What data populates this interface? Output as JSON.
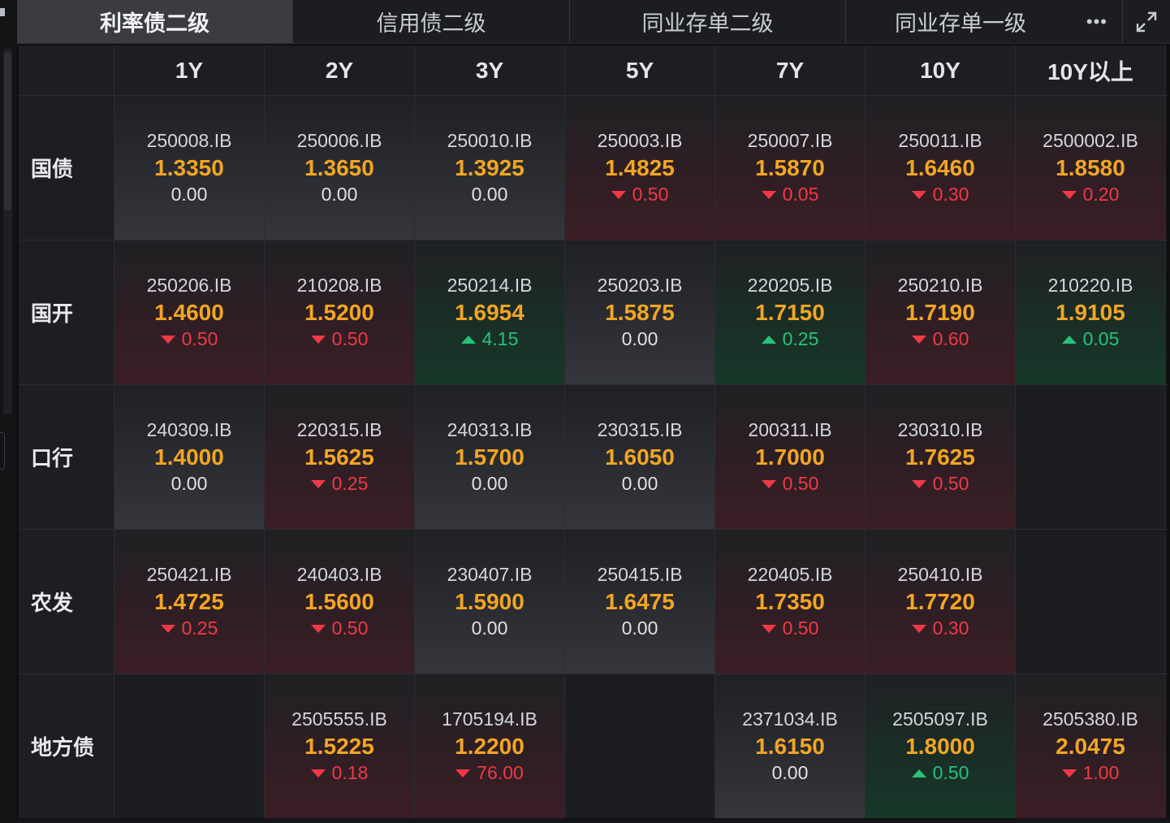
{
  "tabs": [
    {
      "label": "利率债二级",
      "active": true
    },
    {
      "label": "信用债二级",
      "active": false
    },
    {
      "label": "同业存单二级",
      "active": false
    },
    {
      "label": "同业存单一级",
      "active": false
    }
  ],
  "icons": {
    "more": "more-horizontal-icon",
    "expand": "expand-icon"
  },
  "colors": {
    "yield": "#f2a623",
    "down": "#ef3a46",
    "up": "#28c27a"
  },
  "columns": [
    "1Y",
    "2Y",
    "3Y",
    "5Y",
    "7Y",
    "10Y",
    "10Y以上"
  ],
  "rows": [
    {
      "label": "国债",
      "cells": [
        {
          "code": "250008.IB",
          "yield": "1.3350",
          "change": "0.00",
          "dir": "flat"
        },
        {
          "code": "250006.IB",
          "yield": "1.3650",
          "change": "0.00",
          "dir": "flat"
        },
        {
          "code": "250010.IB",
          "yield": "1.3925",
          "change": "0.00",
          "dir": "flat"
        },
        {
          "code": "250003.IB",
          "yield": "1.4825",
          "change": "0.50",
          "dir": "down"
        },
        {
          "code": "250007.IB",
          "yield": "1.5870",
          "change": "0.05",
          "dir": "down"
        },
        {
          "code": "250011.IB",
          "yield": "1.6460",
          "change": "0.30",
          "dir": "down"
        },
        {
          "code": "2500002.IB",
          "yield": "1.8580",
          "change": "0.20",
          "dir": "down"
        }
      ]
    },
    {
      "label": "国开",
      "cells": [
        {
          "code": "250206.IB",
          "yield": "1.4600",
          "change": "0.50",
          "dir": "down"
        },
        {
          "code": "210208.IB",
          "yield": "1.5200",
          "change": "0.50",
          "dir": "down"
        },
        {
          "code": "250214.IB",
          "yield": "1.6954",
          "change": "4.15",
          "dir": "up"
        },
        {
          "code": "250203.IB",
          "yield": "1.5875",
          "change": "0.00",
          "dir": "flat"
        },
        {
          "code": "220205.IB",
          "yield": "1.7150",
          "change": "0.25",
          "dir": "up"
        },
        {
          "code": "250210.IB",
          "yield": "1.7190",
          "change": "0.60",
          "dir": "down"
        },
        {
          "code": "210220.IB",
          "yield": "1.9105",
          "change": "0.05",
          "dir": "up"
        }
      ]
    },
    {
      "label": "口行",
      "cells": [
        {
          "code": "240309.IB",
          "yield": "1.4000",
          "change": "0.00",
          "dir": "flat"
        },
        {
          "code": "220315.IB",
          "yield": "1.5625",
          "change": "0.25",
          "dir": "down"
        },
        {
          "code": "240313.IB",
          "yield": "1.5700",
          "change": "0.00",
          "dir": "flat"
        },
        {
          "code": "230315.IB",
          "yield": "1.6050",
          "change": "0.00",
          "dir": "flat"
        },
        {
          "code": "200311.IB",
          "yield": "1.7000",
          "change": "0.50",
          "dir": "down"
        },
        {
          "code": "230310.IB",
          "yield": "1.7625",
          "change": "0.50",
          "dir": "down"
        },
        null
      ]
    },
    {
      "label": "农发",
      "cells": [
        {
          "code": "250421.IB",
          "yield": "1.4725",
          "change": "0.25",
          "dir": "down"
        },
        {
          "code": "240403.IB",
          "yield": "1.5600",
          "change": "0.50",
          "dir": "down"
        },
        {
          "code": "230407.IB",
          "yield": "1.5900",
          "change": "0.00",
          "dir": "flat"
        },
        {
          "code": "250415.IB",
          "yield": "1.6475",
          "change": "0.00",
          "dir": "flat"
        },
        {
          "code": "220405.IB",
          "yield": "1.7350",
          "change": "0.50",
          "dir": "down"
        },
        {
          "code": "250410.IB",
          "yield": "1.7720",
          "change": "0.30",
          "dir": "down"
        },
        null
      ]
    },
    {
      "label": "地方债",
      "cells": [
        null,
        {
          "code": "2505555.IB",
          "yield": "1.5225",
          "change": "0.18",
          "dir": "down"
        },
        {
          "code": "1705194.IB",
          "yield": "1.2200",
          "change": "76.00",
          "dir": "down"
        },
        null,
        {
          "code": "2371034.IB",
          "yield": "1.6150",
          "change": "0.00",
          "dir": "flat"
        },
        {
          "code": "2505097.IB",
          "yield": "1.8000",
          "change": "0.50",
          "dir": "up"
        },
        {
          "code": "2505380.IB",
          "yield": "2.0475",
          "change": "1.00",
          "dir": "down"
        }
      ]
    }
  ]
}
